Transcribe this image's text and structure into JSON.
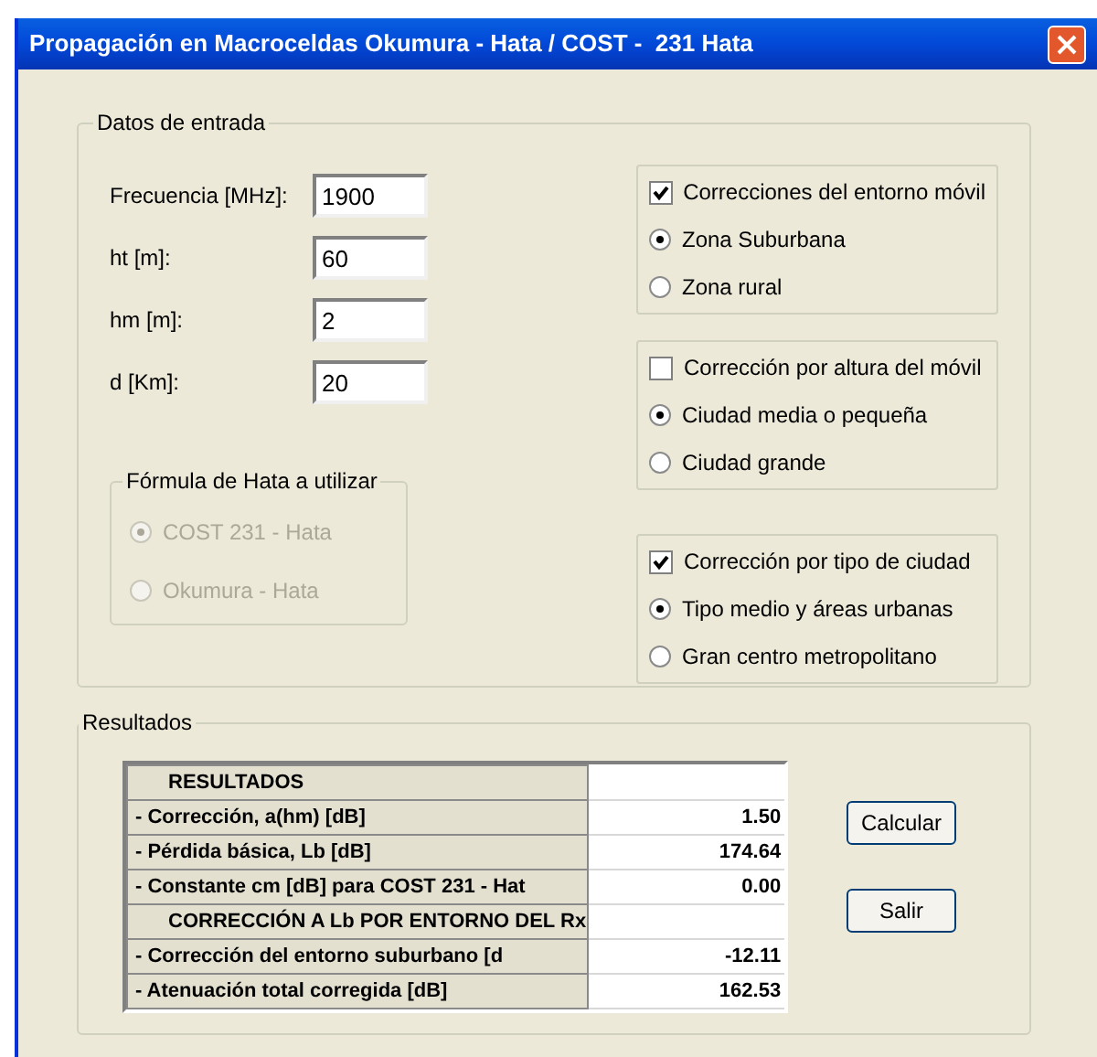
{
  "window": {
    "title": "Propagación en Macroceldas Okumura - Hata / COST -  231 Hata"
  },
  "inputs": {
    "title": "Datos de entrada",
    "fields": [
      {
        "label": "Frecuencia [MHz]:",
        "value": "1900"
      },
      {
        "label": "ht [m]:",
        "value": "60"
      },
      {
        "label": "hm [m]:",
        "value": "2"
      },
      {
        "label": "d [Km]:",
        "value": "20"
      }
    ]
  },
  "formula_group": {
    "title": "Fórmula de Hata a utilizar",
    "disabled": true,
    "options": [
      {
        "label": "COST 231 - Hata",
        "selected": true
      },
      {
        "label": "Okumura - Hata",
        "selected": false
      }
    ]
  },
  "correction_groups": [
    {
      "label": "Correcciones del entorno móvil",
      "checked": true,
      "options": [
        {
          "label": "Zona Suburbana",
          "selected": true
        },
        {
          "label": "Zona rural",
          "selected": false
        }
      ]
    },
    {
      "label": "Corrección por altura del móvil",
      "checked": false,
      "options": [
        {
          "label": "Ciudad media o pequeña",
          "selected": true
        },
        {
          "label": "Ciudad grande",
          "selected": false
        }
      ]
    },
    {
      "label": "Corrección por tipo de ciudad",
      "checked": true,
      "options": [
        {
          "label": "Tipo medio y áreas urbanas",
          "selected": true
        },
        {
          "label": "Gran centro metropolitano",
          "selected": false
        }
      ]
    }
  ],
  "results": {
    "title": "Resultados",
    "rows": [
      {
        "kind": "header",
        "label": "RESULTADOS"
      },
      {
        "kind": "data",
        "label": "- Corrección, a(hm) [dB]",
        "value": "1.50"
      },
      {
        "kind": "data",
        "label": "- Pérdida básica, Lb [dB]",
        "value": "174.64"
      },
      {
        "kind": "data",
        "label": "- Constante cm [dB] para COST 231 - Hat",
        "value": "0.00"
      },
      {
        "kind": "header",
        "label": "CORRECCIÓN A Lb POR ENTORNO DEL Rx"
      },
      {
        "kind": "data",
        "label": "- Corrección del entorno suburbano [d",
        "value": "-12.11"
      },
      {
        "kind": "data",
        "label": "- Atenuación total corregida [dB]",
        "value": "162.53"
      }
    ]
  },
  "buttons": [
    "Calcular",
    "Salir"
  ]
}
